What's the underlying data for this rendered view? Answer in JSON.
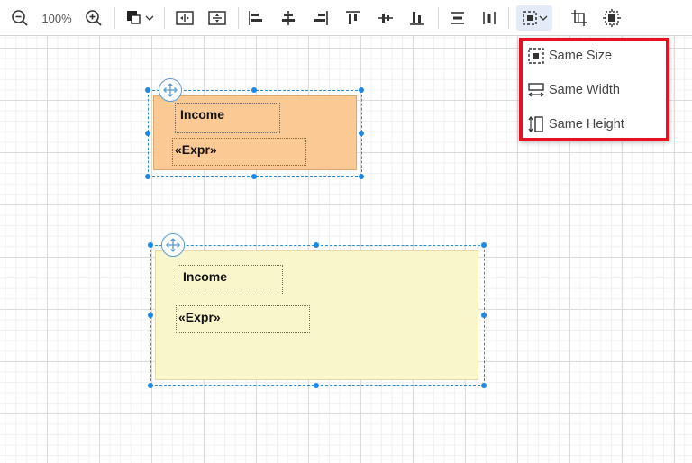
{
  "toolbar": {
    "zoom_level": "100%",
    "icons": [
      "zoom-out-icon",
      "zoom-in-icon",
      "fill-color-icon",
      "chevron-down-icon",
      "fit-width-icon",
      "fit-height-icon",
      "align-left-icon",
      "align-center-icon",
      "align-right-icon",
      "align-top-icon",
      "align-middle-icon",
      "align-bottom-icon",
      "distribute-horizontal-icon",
      "distribute-vertical-icon",
      "size-icon",
      "crop-icon",
      "shrink-icon"
    ]
  },
  "bands": [
    {
      "color": "#fbc994",
      "fields": [
        {
          "label": "Income"
        },
        {
          "label": "«Expr»"
        }
      ]
    },
    {
      "color": "#faf6cc",
      "fields": [
        {
          "label": "Income"
        },
        {
          "label": "«Expr»"
        }
      ]
    }
  ],
  "size_menu": {
    "items": [
      {
        "label": "Same Size",
        "icon": "same-size-icon"
      },
      {
        "label": "Same Width",
        "icon": "same-width-icon"
      },
      {
        "label": "Same Height",
        "icon": "same-height-icon"
      }
    ]
  },
  "colors": {
    "selection": "#2b8fd6",
    "highlight_box": "#e81123",
    "band_orange": "#fbc994",
    "band_yellow": "#faf6cc"
  }
}
